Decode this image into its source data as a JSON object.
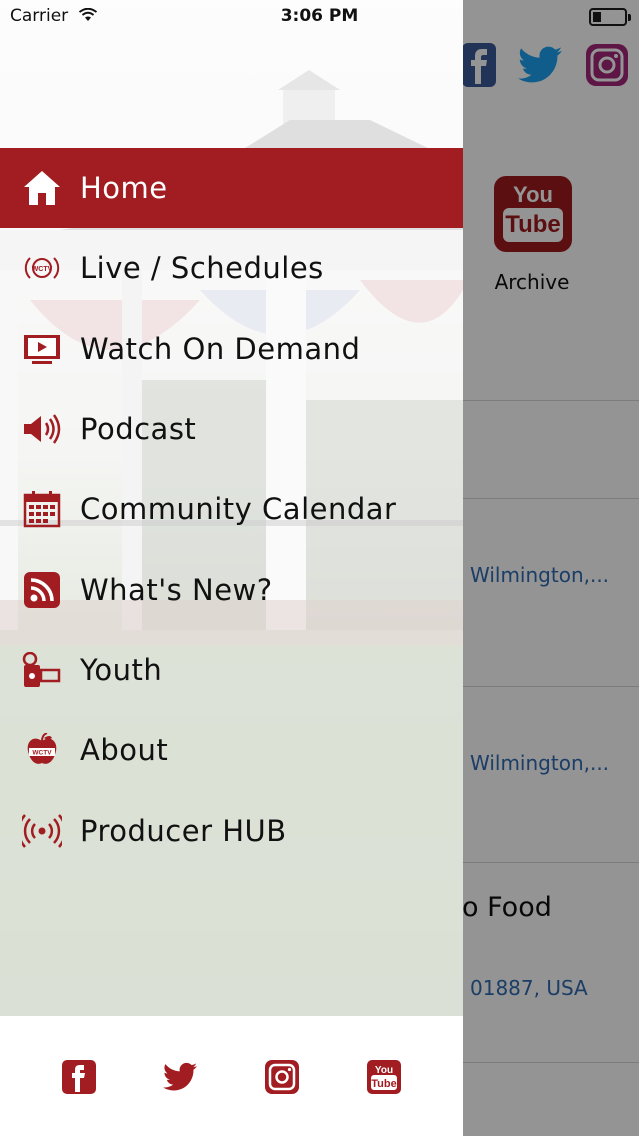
{
  "status_bar": {
    "carrier": "Carrier",
    "time": "3:06 PM"
  },
  "menu": {
    "items": [
      {
        "label": "Home",
        "icon": "home-icon",
        "active": true
      },
      {
        "label": "Live / Schedules",
        "icon": "wctv-live-icon"
      },
      {
        "label": "Watch On Demand",
        "icon": "tv-play-icon"
      },
      {
        "label": "Podcast",
        "icon": "speaker-icon"
      },
      {
        "label": "Community Calendar",
        "icon": "calendar-icon"
      },
      {
        "label": "What's New?",
        "icon": "rss-icon"
      },
      {
        "label": "Youth",
        "icon": "camcorder-icon"
      },
      {
        "label": "About",
        "icon": "apple-icon"
      },
      {
        "label": "Producer HUB",
        "icon": "broadcast-icon"
      }
    ]
  },
  "footer": {
    "icons": [
      "facebook-icon",
      "twitter-icon",
      "instagram-icon",
      "youtube-icon"
    ]
  },
  "background": {
    "yt_you": "You",
    "yt_tube": "Tube",
    "archive_label": "Archive",
    "link_1": "Wilmington,...",
    "link_2": "Wilmington,...",
    "title_fragment": "o Food",
    "address_fragment": "01887, USA"
  },
  "colors": {
    "brand_red": "#a21d22",
    "link_blue": "#2f69b0",
    "twitter_blue": "#1da1f2",
    "facebook_blue": "#3b5998",
    "instagram_purple": "#a12778"
  },
  "wctv_badge": "WCTV"
}
